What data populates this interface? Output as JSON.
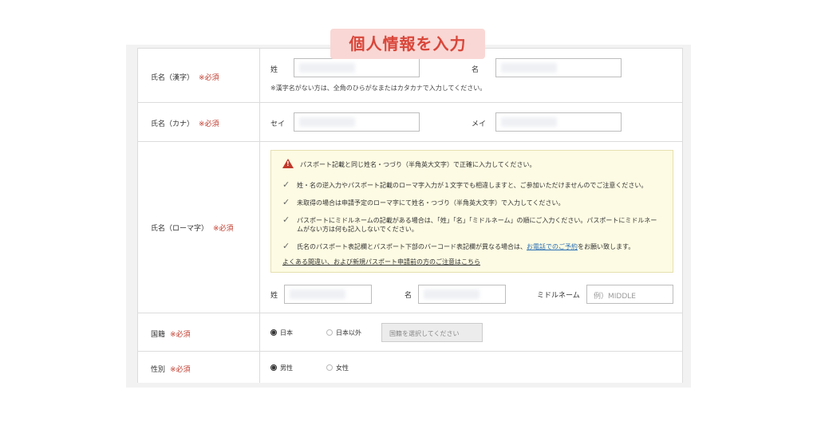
{
  "banner": "個人情報を入力",
  "rows": {
    "kanji": {
      "label": "氏名（漢字）",
      "required": "※必須",
      "last_label": "姓",
      "first_label": "名",
      "note": "※漢字名がない方は、全角のひらがなまたはカタカナで入力してください。"
    },
    "kana": {
      "label": "氏名（カナ）",
      "required": "※必須",
      "last_label": "セイ",
      "first_label": "メイ"
    },
    "roman": {
      "label": "氏名（ローマ字）",
      "required": "※必須",
      "notice": {
        "title": "パスポート記載と同じ姓名・つづり（半角英大文字）で正確に入力してください。",
        "items": [
          "姓・名の逆入力やパスポート記載のローマ字入力が１文字でも相違しますと、ご参加いただけませんのでご注意ください。",
          "未取得の場合は申請予定のローマ字にて姓名・つづり（半角英大文字）で入力してください。",
          "パスポートにミドルネームの記載がある場合は、「姓」「名」「ミドルネーム」の順にご入力ください。パスポートにミドルネー",
          "ムがない方は何も記入しないでください。",
          "氏名のパスポート表記欄とパスポート下部のバーコード表記欄が異なる場合は、"
        ],
        "phone_link": "お電話でのご予約",
        "phone_suffix": "をお願い致します。",
        "faq_link": "よくある間違い、および新規パスポート申請前の方のご注意はこちら"
      },
      "last_label": "姓",
      "first_label": "名",
      "middle_label": "ミドルネーム",
      "middle_placeholder": "例）MIDDLE"
    },
    "nationality": {
      "label": "国籍",
      "required": "※必須",
      "option_japan": "日本",
      "option_other": "日本以外",
      "select_placeholder": "国籍を選択してください"
    },
    "gender": {
      "label": "性別",
      "required": "※必須",
      "option_male": "男性",
      "option_female": "女性"
    }
  },
  "colors": {
    "required": "#c0392b",
    "banner_bg": "#f9d7d4",
    "banner_text": "#d9463a",
    "notice_bg": "#fdfbe3",
    "link": "#2a6fb3"
  }
}
